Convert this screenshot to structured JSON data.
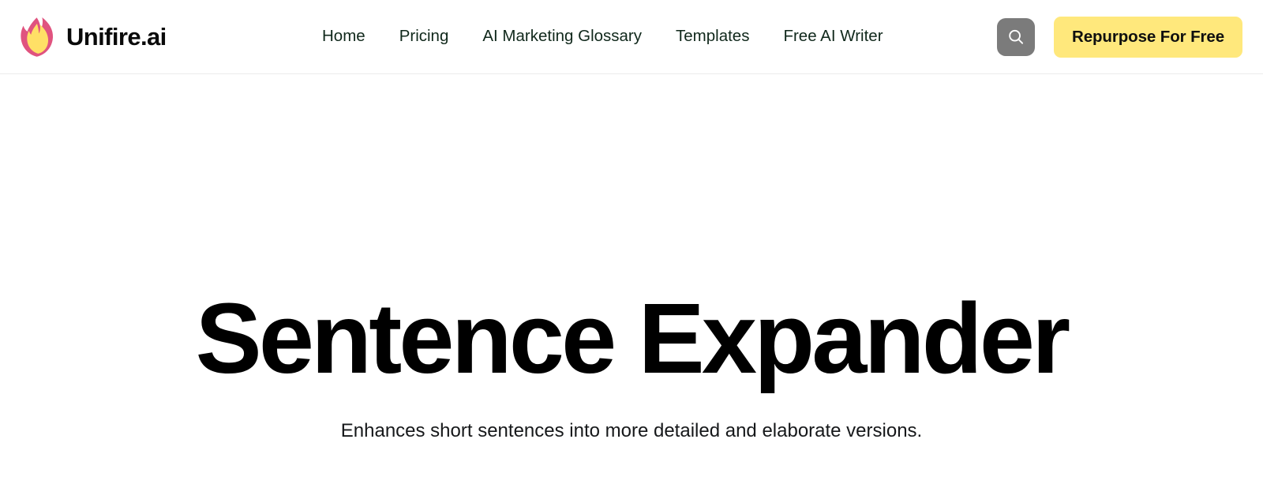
{
  "header": {
    "brand": {
      "name": "Unifire.ai",
      "logo_icon": "flame-icon",
      "logo_outer_color": "#e0537f",
      "logo_inner_color": "#ffe066"
    },
    "nav": [
      {
        "label": "Home"
      },
      {
        "label": "Pricing"
      },
      {
        "label": "AI Marketing Glossary"
      },
      {
        "label": "Templates"
      },
      {
        "label": "Free AI Writer"
      }
    ],
    "actions": {
      "search_icon": "search-icon",
      "search_button_color": "#7b7b7b",
      "cta_label": "Repurpose For Free",
      "cta_background": "#ffe87c",
      "cta_text_color": "#0f0f0f"
    }
  },
  "hero": {
    "title": "Sentence Expander",
    "subtitle": "Enhances short sentences into more detailed and elaborate versions."
  }
}
